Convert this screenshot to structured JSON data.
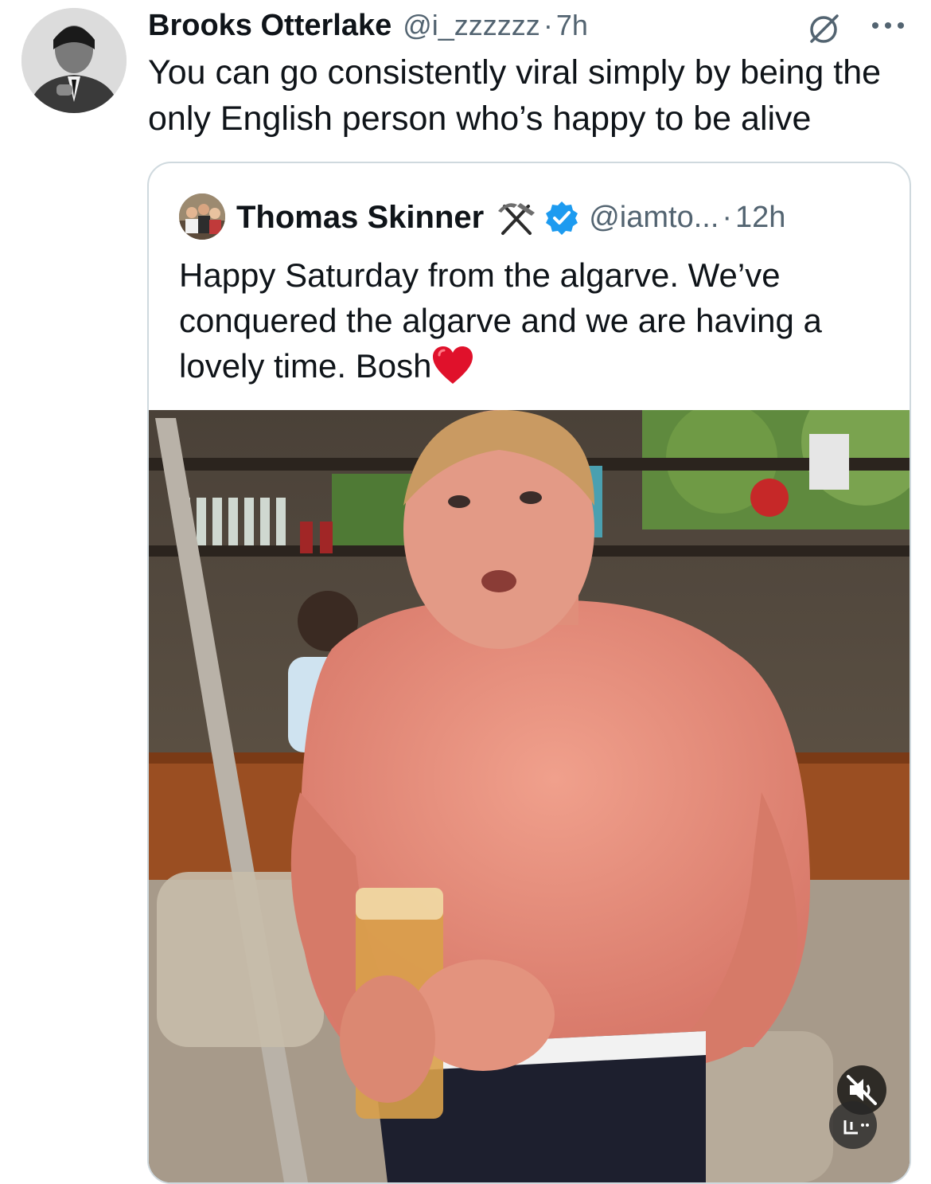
{
  "tweet": {
    "author_name": "Brooks Otterlake",
    "handle": "@i_zzzzzz",
    "separator": "·",
    "time": "7h",
    "text": "You can go consistently viral simply by being the only English person who’s happy to be alive",
    "avatar_icon": "profile-photo",
    "actions": {
      "grok_icon": "grok-icon",
      "more_icon": "more-icon"
    }
  },
  "quote": {
    "author_name": "Thomas Skinner",
    "name_emoji_icon": "hammer-and-pick-icon",
    "verified_icon": "verified-badge-icon",
    "handle": "@iamto...",
    "separator": "·",
    "time": "12h",
    "text": "Happy Saturday from the algarve. We’ve conquered the algarve and we are having a lovely time. Bosh",
    "text_emoji_icon": "red-heart-icon",
    "media": {
      "type": "video",
      "mute_icon": "muted-speaker-icon",
      "badge_icon": "reels-badge-icon"
    }
  },
  "colors": {
    "text_primary": "#0f1419",
    "text_secondary": "#536471",
    "border": "#cfd9de",
    "verified": "#1d9bf0",
    "heart": "#e0112b"
  }
}
